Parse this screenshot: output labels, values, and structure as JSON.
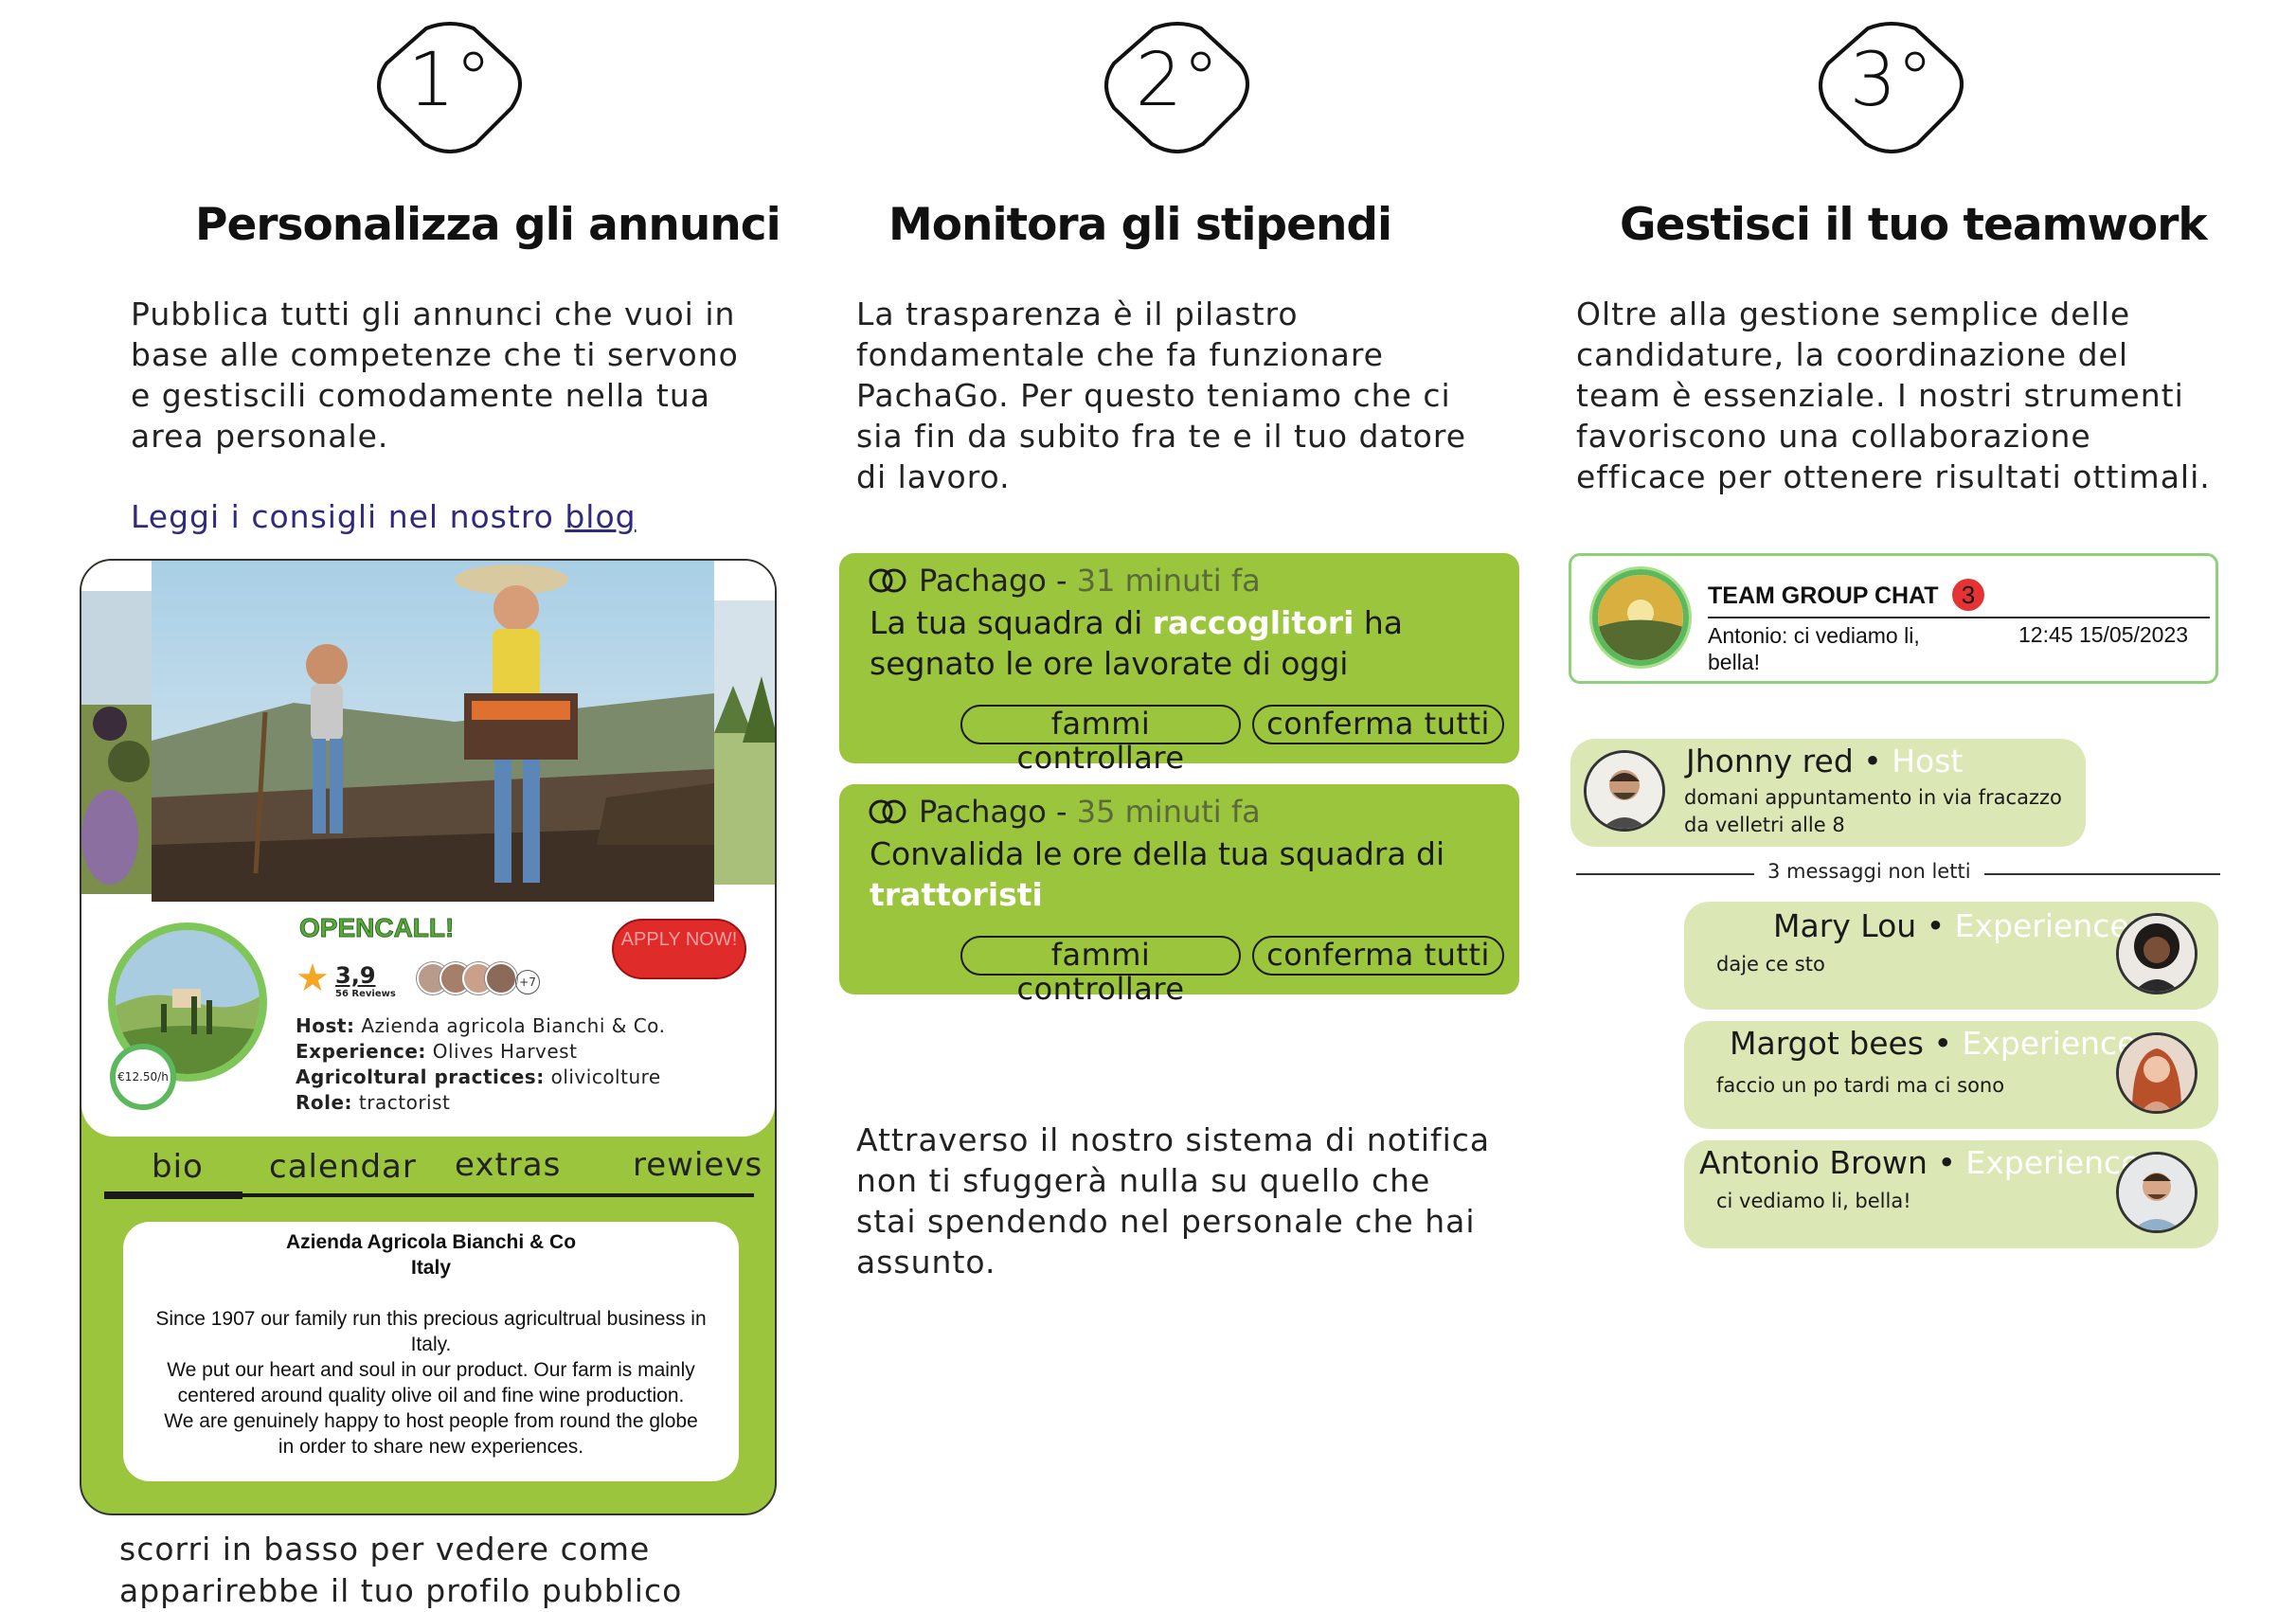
{
  "columns": [
    {
      "step": "1°",
      "title": "Personalizza gli annunci",
      "paragraph": "Pubblica tutti gli annunci che vuoi in base alle competenze che ti servono e gestiscili comodamente nella tua area personale.",
      "blog_prefix": "Leggi i consigli nel nostro",
      "blog_link": "blog"
    },
    {
      "step": "2°",
      "title": "Monitora gli stipendi",
      "paragraph": "La trasparenza è il pilastro fondamentale che fa funzionare PachaGo. Per questo teniamo che ci sia fin da subito fra te e il tuo datore di lavoro.",
      "footer_paragraph": "Attraverso il nostro sistema di notifica non ti sfuggerà nulla su quello che stai spendendo nel personale che hai assunto."
    },
    {
      "step": "3°",
      "title": "Gestisci il tuo teamwork",
      "paragraph": "Oltre alla gestione semplice delle candidature, la coordinazione del team è essenziale. I nostri strumenti favoriscono una collaborazione efficace per ottenere risultati ottimali."
    }
  ],
  "card": {
    "badge": "OPENCALL!",
    "apply_button": "APPLY NOW!",
    "rating": "3,9",
    "reviews": "56 Reviews",
    "more_count": "+7",
    "price": "€12.50/h",
    "info": [
      {
        "label": "Host:",
        "value": "Azienda agricola Bianchi & Co."
      },
      {
        "label": "Experience:",
        "value": "Olives Harvest"
      },
      {
        "label": "Agricoltural practices:",
        "value": "olivicolture"
      },
      {
        "label": "Role:",
        "value": "tractorist"
      }
    ],
    "tabs": [
      "bio",
      "calendar",
      "extras",
      "rewievs"
    ],
    "bio_title": "Azienda Agricola Bianchi & Co",
    "bio_subtitle": "Italy",
    "bio_text_1": "Since 1907 our family run this precious agricultrual business in Italy.",
    "bio_text_2": "We put our heart and soul in our product. Our farm is mainly centered around quality olive oil and fine wine production.",
    "bio_text_3": "We are genuinely happy to host people from round the globe in order to share new experiences.",
    "scroll_note_1": "scorri in basso per vedere come",
    "scroll_note_2": "apparirebbe il tuo profilo pubblico"
  },
  "notifications": [
    {
      "sender": "Pachago",
      "separator": " - ",
      "time": "31 minuti fa",
      "text_before": "La tua squadra di ",
      "highlight": "raccoglitori",
      "text_after": " ha segnato le ore lavorate di oggi",
      "action_check": "fammi controllare",
      "action_confirm": "conferma tutti"
    },
    {
      "sender": "Pachago",
      "separator": " - ",
      "time": "35 minuti fa",
      "text_before": "Convalida le ore della tua squadra di ",
      "highlight": "trattoristi",
      "text_after": "",
      "action_check": "fammi controllare",
      "action_confirm": "conferma tutti"
    }
  ],
  "team_chat": {
    "title": "TEAM GROUP CHAT",
    "unread": "3",
    "last_message": "Antonio:  ci vediamo li, bella!",
    "timestamp": "12:45 15/05/2023"
  },
  "messages": [
    {
      "name": "Jhonny red",
      "dot": " • ",
      "role": "Host",
      "text": "domani appuntamento in via fracazzo da velletri alle 8"
    },
    {
      "name": "Mary Lou",
      "dot": " • ",
      "role": "Experiencer",
      "text": "daje ce sto"
    },
    {
      "name": "Margot bees",
      "dot": " • ",
      "role": "Experiencer",
      "text": "faccio un po tardi ma ci sono"
    },
    {
      "name": "Antonio Brown",
      "dot": " • ",
      "role": "Experiencer",
      "text": "ci vediamo li, bella!"
    }
  ],
  "unread_divider": "3 messaggi non letti",
  "colors": {
    "brand_green": "#9bc53d",
    "light_green": "#dbe8b6",
    "link_blue": "#2e2a7e",
    "badge_red": "#e53232"
  }
}
